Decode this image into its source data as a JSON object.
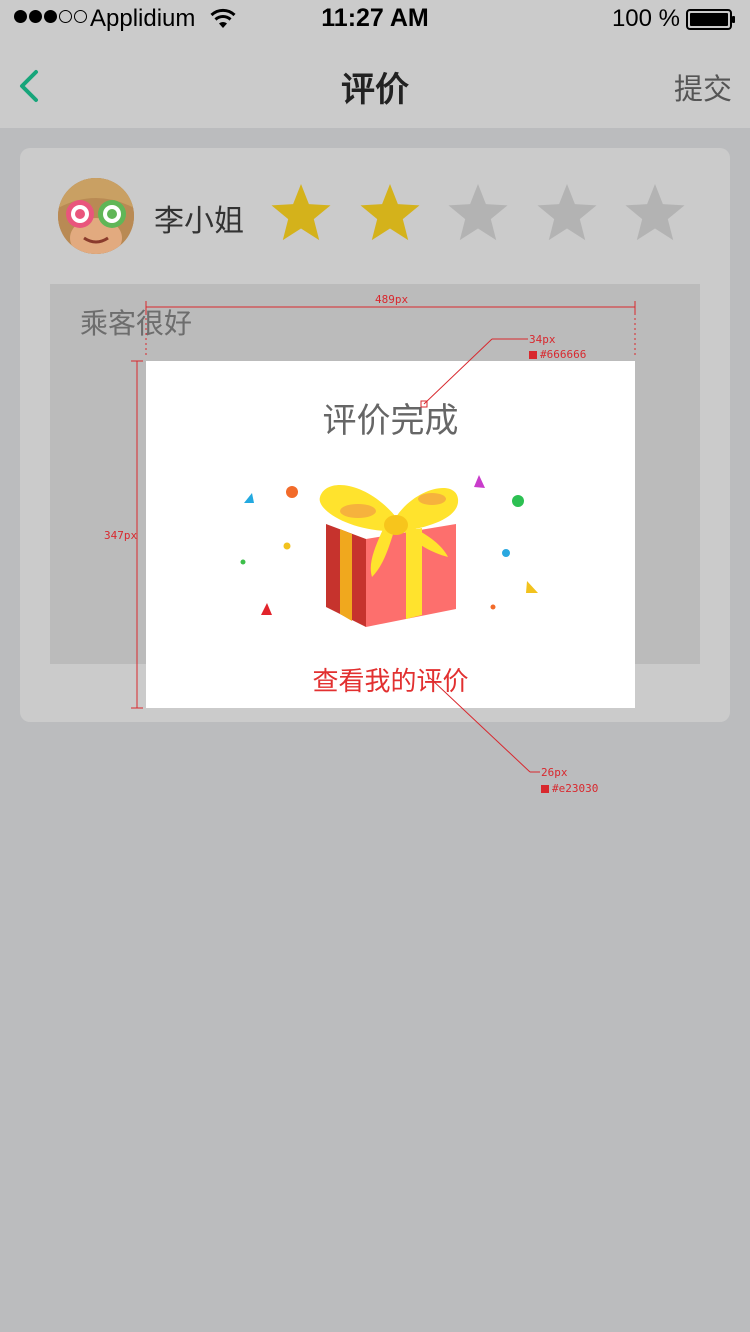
{
  "status_bar": {
    "carrier": "Applidium",
    "time": "11:27 AM",
    "battery": "100 %"
  },
  "nav": {
    "title": "评价",
    "submit": "提交",
    "back_icon": "chevron-left-icon",
    "accent_color": "#17a57a"
  },
  "review": {
    "user_name": "李小姐",
    "rating": 2,
    "max_rating": 5,
    "star_active_color": "#d4b21b",
    "star_inactive_color": "#b3b3b3",
    "comment": "乘客很好"
  },
  "popup": {
    "title": "评价完成",
    "link": "查看我的评价",
    "title_color": "#666666",
    "link_color": "#e23030",
    "image": "gift-box-icon"
  },
  "annotations": {
    "width_label": "489px",
    "height_label": "347px",
    "title_size_label": "34px",
    "title_color_label": "#666666",
    "link_size_label": "26px",
    "link_color_label": "#e23030"
  }
}
